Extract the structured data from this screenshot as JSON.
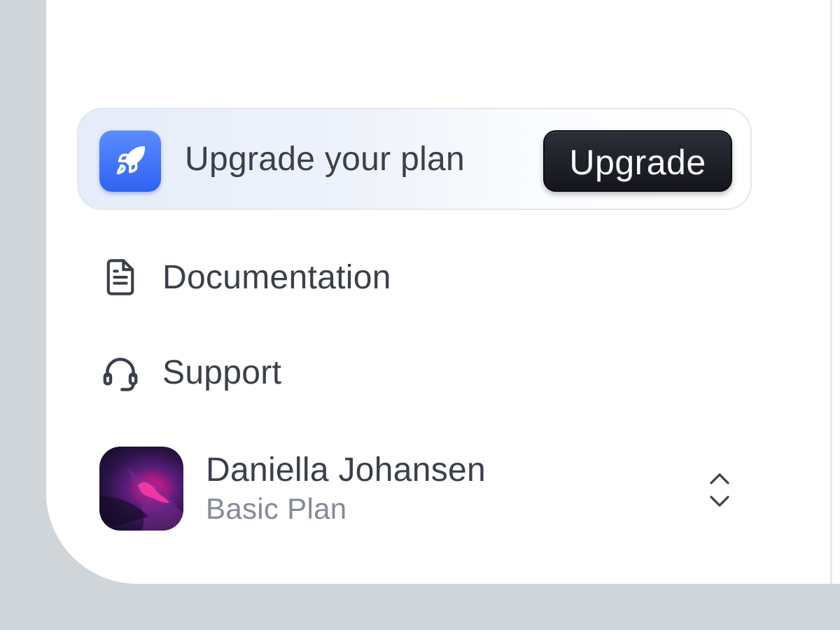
{
  "upgrade": {
    "icon": "rocket-icon",
    "text": "Upgrade your plan",
    "button_label": "Upgrade",
    "accent_color": "#3b6ef5"
  },
  "nav": {
    "items": [
      {
        "label": "Documentation",
        "icon": "document-icon"
      },
      {
        "label": "Support",
        "icon": "headset-icon"
      }
    ]
  },
  "profile": {
    "name": "Daniella Johansen",
    "plan": "Basic Plan",
    "toggle_icon": "chevron-up-down-icon"
  }
}
